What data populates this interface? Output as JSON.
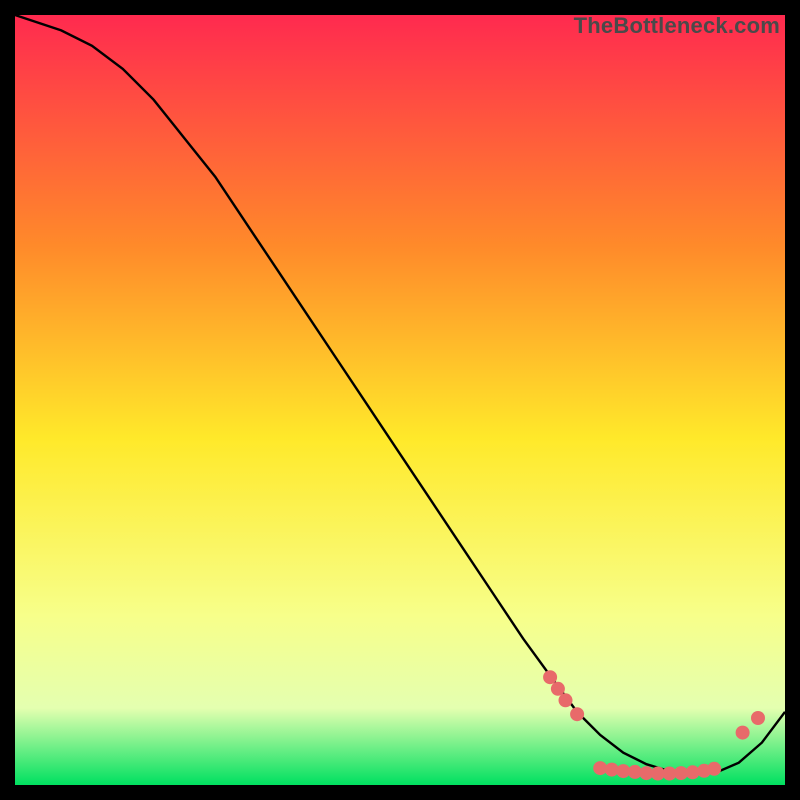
{
  "watermark": "TheBottleneck.com",
  "chart_data": {
    "type": "line",
    "title": "",
    "xlabel": "",
    "ylabel": "",
    "xlim": [
      0,
      100
    ],
    "ylim": [
      0,
      100
    ],
    "background_gradient": {
      "top": "#ff2a4f",
      "mid_upper": "#ff8a2a",
      "mid": "#ffe92a",
      "mid_lower": "#f7ff8a",
      "band": "#e4ffb0",
      "bottom": "#00e060"
    },
    "curve": {
      "name": "bottleneck-curve",
      "x": [
        0,
        6,
        10,
        14,
        18,
        22,
        26,
        30,
        34,
        38,
        42,
        46,
        50,
        54,
        58,
        62,
        66,
        70,
        73,
        76,
        79,
        82,
        85,
        88,
        91,
        94,
        97,
        100
      ],
      "y": [
        100,
        98,
        96,
        93,
        89,
        84,
        79,
        73,
        67,
        61,
        55,
        49,
        43,
        37,
        31,
        25,
        19,
        13.5,
        9.5,
        6.5,
        4.2,
        2.7,
        1.8,
        1.4,
        1.6,
        2.9,
        5.5,
        9.5
      ]
    },
    "markers": {
      "name": "highlight-dots",
      "color": "#e86a6a",
      "points": [
        {
          "x": 69.5,
          "y": 14.0
        },
        {
          "x": 70.5,
          "y": 12.5
        },
        {
          "x": 71.5,
          "y": 11.0
        },
        {
          "x": 73.0,
          "y": 9.2
        },
        {
          "x": 76.0,
          "y": 2.2
        },
        {
          "x": 77.5,
          "y": 2.0
        },
        {
          "x": 79.0,
          "y": 1.8
        },
        {
          "x": 80.5,
          "y": 1.7
        },
        {
          "x": 82.0,
          "y": 1.55
        },
        {
          "x": 83.5,
          "y": 1.5
        },
        {
          "x": 85.0,
          "y": 1.5
        },
        {
          "x": 86.5,
          "y": 1.55
        },
        {
          "x": 88.0,
          "y": 1.65
        },
        {
          "x": 89.5,
          "y": 1.85
        },
        {
          "x": 90.8,
          "y": 2.1
        },
        {
          "x": 94.5,
          "y": 6.8
        },
        {
          "x": 96.5,
          "y": 8.7
        }
      ]
    }
  }
}
